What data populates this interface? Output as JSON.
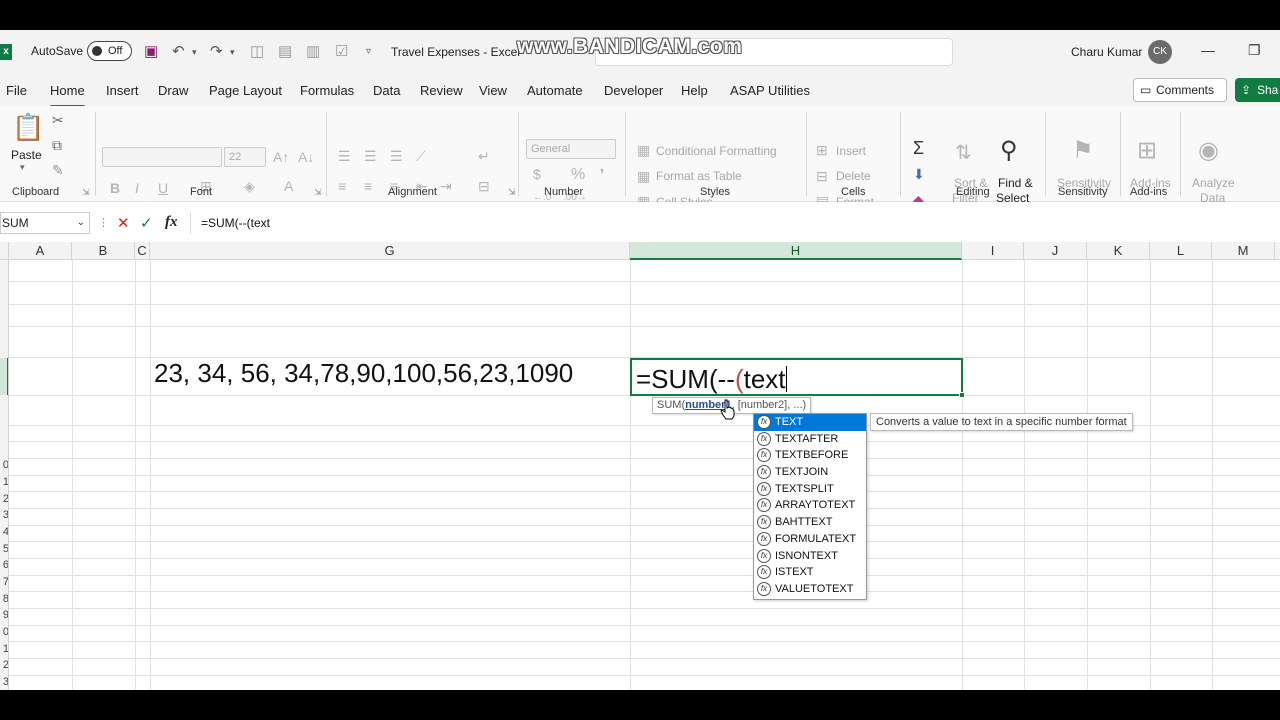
{
  "titlebar": {
    "autosave_label": "AutoSave",
    "autosave_state": "Off",
    "doc_title": "Travel Expenses  -  Excel",
    "watermark": "www.BANDICAM.com",
    "user_name": "Charu Kumar",
    "user_initials": "CK",
    "minimize": "—",
    "restore": "❐"
  },
  "menu": {
    "tabs": [
      "File",
      "Home",
      "Insert",
      "Draw",
      "Page Layout",
      "Formulas",
      "Data",
      "Review",
      "View",
      "Automate",
      "Developer",
      "Help",
      "ASAP Utilities"
    ],
    "active_tab": "Home",
    "comments_label": "Comments",
    "share_label": "Sha"
  },
  "ribbon": {
    "groups": [
      "Clipboard",
      "Font",
      "Alignment",
      "Number",
      "Styles",
      "Cells",
      "Editing",
      "Sensitivity",
      "Add-ins"
    ],
    "paste_label": "Paste",
    "font_size": "22",
    "number_format": "General",
    "conditional_formatting": "Conditional Formatting",
    "format_as_table": "Format as Table",
    "cell_styles": "Cell Styles",
    "insert": "Insert",
    "delete": "Delete",
    "format": "Format",
    "sort_filter_1": "Sort &",
    "sort_filter_2": "Filter",
    "find_select_1": "Find &",
    "find_select_2": "Select",
    "sensitivity": "Sensitivity",
    "addins": "Add-ins",
    "analyze_1": "Analyze",
    "analyze_2": "Data"
  },
  "formula_bar": {
    "name_box": "SUM",
    "fx": "fx",
    "formula": "=SUM(--(text"
  },
  "grid": {
    "columns": [
      "A",
      "B",
      "C",
      "G",
      "H",
      "I",
      "J",
      "K",
      "L",
      "M"
    ],
    "selected_column": "H",
    "row_numbers": [
      "0",
      "1",
      "2",
      "3",
      "4",
      "5",
      "6",
      "7",
      "8",
      "9",
      "0",
      "1",
      "2",
      "3",
      "4"
    ]
  },
  "cells": {
    "g_value": "23, 34, 56, 34,78,90,100,56,23,1090",
    "h_formula_prefix": "=SUM(--",
    "h_formula_paren": "(",
    "h_formula_text": "text"
  },
  "syntax_tip": {
    "prefix": "SUM(",
    "current_arg": "number1",
    "rest": ", [number2], ...)"
  },
  "autocomplete": {
    "items": [
      "TEXT",
      "TEXTAFTER",
      "TEXTBEFORE",
      "TEXTJOIN",
      "TEXTSPLIT",
      "ARRAYTOTEXT",
      "BAHTTEXT",
      "FORMULATEXT",
      "ISNONTEXT",
      "ISTEXT",
      "VALUETOTEXT"
    ],
    "selected": "TEXT",
    "description": "Converts a value to text in a specific number format"
  }
}
